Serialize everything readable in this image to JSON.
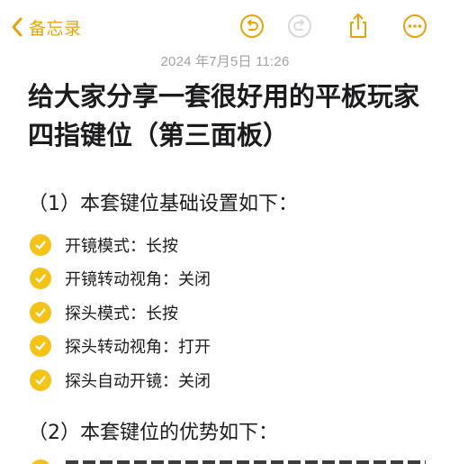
{
  "toolbar": {
    "back_label": "备忘录",
    "icons": {
      "back": "chevron-left-icon",
      "undo": "undo-icon",
      "redo": "redo-icon",
      "share": "share-icon",
      "more": "more-icon"
    },
    "accent_color": "#e6a40c",
    "disabled_color": "#d9d9dc"
  },
  "note": {
    "timestamp": "2024 年7月5日 11:26",
    "title": "给大家分享一套很好用的平板玩家四指键位（第三面板）",
    "section1_heading": "（1）本套键位基础设置如下：",
    "checklist": [
      {
        "label": "开镜模式：长按",
        "checked": true
      },
      {
        "label": "开镜转动视角：关闭",
        "checked": true
      },
      {
        "label": "探头模式：长按",
        "checked": true
      },
      {
        "label": "探头转动视角：打开",
        "checked": true
      },
      {
        "label": "探头自动开镜：关闭",
        "checked": true
      }
    ],
    "section2_heading": "（2）本套键位的优势如下：",
    "check_color": "#f3c318"
  }
}
